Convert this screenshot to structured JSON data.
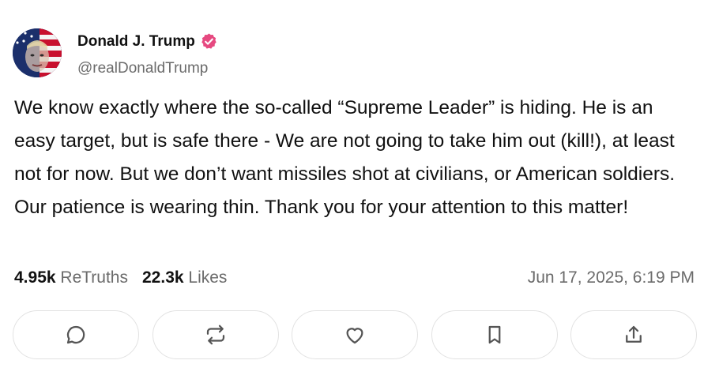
{
  "author": {
    "name": "Donald J. Trump",
    "handle": "@realDonaldTrump",
    "verified": true,
    "verified_badge_color": "#e64980"
  },
  "post": {
    "text": "We know exactly where the so-called “Supreme Leader” is hiding. He is an easy target, but is safe there - We are not going to take him out (kill!), at least not for now. But we don’t want missiles shot at civilians, or American soldiers. Our patience is wearing thin. Thank you for your attention to this matter!"
  },
  "stats": {
    "retruths_count": "4.95k",
    "retruths_label": "ReTruths",
    "likes_count": "22.3k",
    "likes_label": "Likes"
  },
  "timestamp": "Jun 17, 2025, 6:19 PM",
  "actions": [
    {
      "icon": "reply-icon"
    },
    {
      "icon": "retruth-icon"
    },
    {
      "icon": "like-heart-icon"
    },
    {
      "icon": "bookmark-icon"
    },
    {
      "icon": "share-icon"
    }
  ],
  "colors": {
    "text": "#111111",
    "muted": "#6b6b6b",
    "button_border": "#e2e2e2",
    "icon": "#555555"
  }
}
